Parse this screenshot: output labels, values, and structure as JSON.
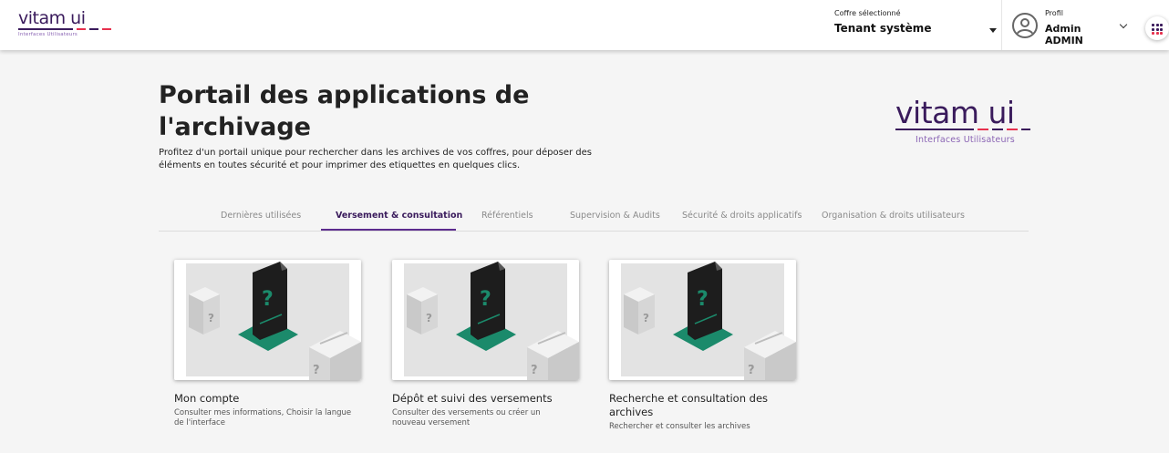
{
  "header": {
    "logo_text": "vitam ui",
    "logo_subtitle": "Interfaces Utilisateurs",
    "coffre_label": "Coffre sélectionné",
    "coffre_value": "Tenant système",
    "profil_label": "Profil",
    "profil_value": "Admin ADMIN"
  },
  "hero": {
    "title": "Portail des applications de l'archivage",
    "description": "Profitez d'un portail unique pour rechercher dans les archives de vos coffres, pour déposer des éléments en toutes sécurité et pour imprimer des etiquettes en quelques clics.",
    "logo_text": "vitam ui",
    "logo_subtitle": "Interfaces Utilisateurs"
  },
  "tabs": [
    {
      "label": "Dernières utilisées",
      "active": false
    },
    {
      "label": "Versement & consultation",
      "active": true
    },
    {
      "label": "Référentiels",
      "active": false
    },
    {
      "label": "Supervision & Audits",
      "active": false
    },
    {
      "label": "Sécurité & droits applicatifs",
      "active": false
    },
    {
      "label": "Organisation & droits utilisateurs",
      "active": false
    }
  ],
  "cards": [
    {
      "title": "Mon compte",
      "description": "Consulter mes informations, Choisir la langue de l'interface"
    },
    {
      "title": "Dépôt et suivi des versements",
      "description": "Consulter des versements ou créer un nouveau versement"
    },
    {
      "title": "Recherche et consultation des archives",
      "description": "Rechercher et consulter les archives"
    }
  ],
  "colors": {
    "brand": "#3a1b5c",
    "accent": "#5c2b8e",
    "illustration_teal": "#1b8a6b",
    "dash_red": "#e7304d"
  },
  "icons": [
    "user-avatar-icon",
    "chevron-down-icon",
    "apps-grid-icon",
    "caret-down-icon"
  ]
}
